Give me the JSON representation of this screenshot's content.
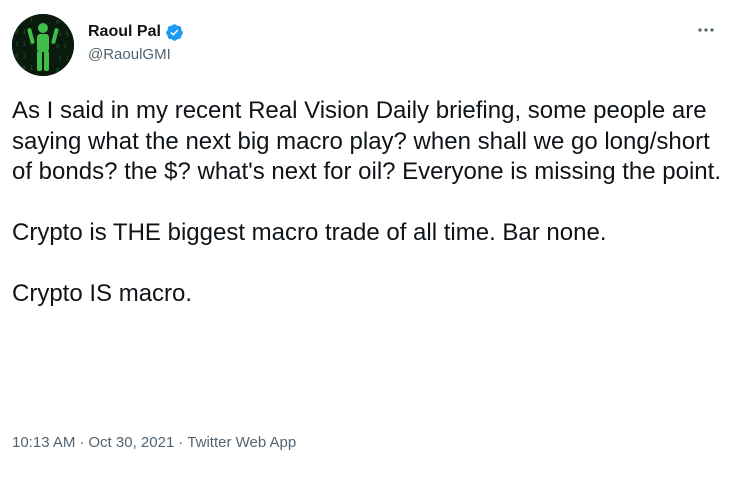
{
  "author": {
    "display_name": "Raoul Pal",
    "handle": "@RaoulGMI",
    "verified": true,
    "avatar_icon": "matrix-figure-avatar"
  },
  "tweet": {
    "paragraphs": [
      "As I said in my recent Real Vision Daily briefing, some people are saying what the next big macro play? when shall we go long/short of bonds? the $? what's next for oil? Everyone is missing the point.",
      "Crypto is THE biggest macro trade of all time. Bar none.",
      "Crypto IS macro."
    ]
  },
  "meta": {
    "time": "10:13 AM",
    "separator": "·",
    "date": "Oct 30, 2021",
    "source": "Twitter Web App"
  },
  "colors": {
    "text": "#0f1419",
    "secondary": "#536471",
    "verified_badge": "#1d9bf0"
  },
  "icons": {
    "verified": "verified-badge-icon",
    "more": "more-options-icon"
  }
}
